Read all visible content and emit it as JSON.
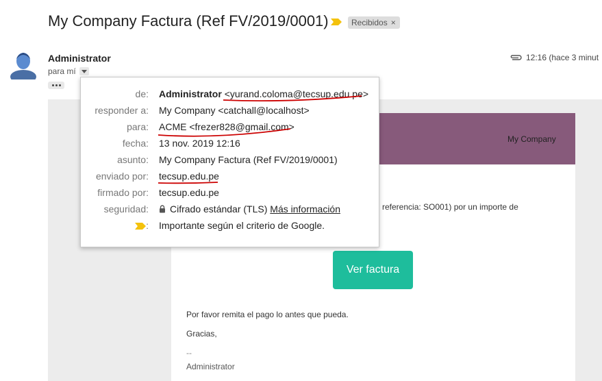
{
  "email": {
    "subject": "My Company Factura (Ref FV/2019/0001)",
    "label": "Recibidos",
    "label_close": "×",
    "sender": "Administrator",
    "to_me": "para mí",
    "time": "12:16 (hace 3 minut"
  },
  "details": {
    "from_label": "de:",
    "from_name": "Administrator",
    "from_email": "<yurand.coloma@tecsup.edu.pe>",
    "reply_label": "responder a:",
    "reply_value": "My Company <catchall@localhost>",
    "to_label": "para:",
    "to_value": "ACME <frezer828@gmail.com>",
    "date_label": "fecha:",
    "date_value": "13 nov. 2019 12:16",
    "subject_label": "asunto:",
    "subject_value": "My Company Factura (Ref FV/2019/0001)",
    "sent_label": "enviado por:",
    "sent_value": "tecsup.edu.pe",
    "signed_label": "firmado por:",
    "signed_value": "tecsup.edu.pe",
    "security_label": "seguridad:",
    "security_value": "Cifrado estándar (TLS)",
    "security_link": "Más información",
    "importance_colon": ":",
    "importance_value": "Importante según el criterio de Google."
  },
  "body": {
    "company": "My Company",
    "text_fragment": "n referencia: SO001) por un importe de",
    "button": "Ver factura",
    "pay_text": "Por favor remita el pago lo antes que pueda.",
    "thanks": "Gracias,",
    "sig_dash": "--",
    "sig_name": "Administrator"
  },
  "colors": {
    "header_purple": "#875a7b",
    "button_teal": "#1ebd9c",
    "importance_yellow": "#f4c20d",
    "annotation_red": "#cc0000"
  }
}
